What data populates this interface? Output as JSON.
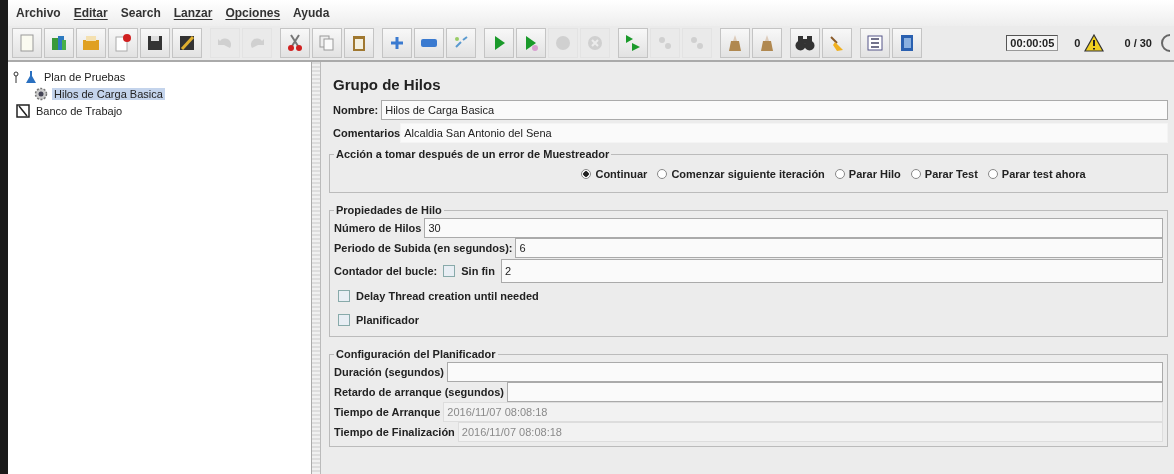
{
  "menu": [
    {
      "label": "Archivo",
      "mnemonic": false
    },
    {
      "label": "Editar",
      "mnemonic": true
    },
    {
      "label": "Search",
      "mnemonic": false
    },
    {
      "label": "Lanzar",
      "mnemonic": true
    },
    {
      "label": "Opciones",
      "mnemonic": true
    },
    {
      "label": "Ayuda",
      "mnemonic": false
    }
  ],
  "toolbar_groups": [
    {
      "buttons": [
        {
          "kind": "new",
          "disabled": false
        },
        {
          "kind": "templates",
          "disabled": false
        },
        {
          "kind": "open",
          "disabled": false
        },
        {
          "kind": "close",
          "disabled": false
        },
        {
          "kind": "save",
          "disabled": false
        },
        {
          "kind": "save_as",
          "disabled": false
        }
      ]
    },
    {
      "buttons": [
        {
          "kind": "undo",
          "disabled": true
        },
        {
          "kind": "redo",
          "disabled": true
        }
      ]
    },
    {
      "buttons": [
        {
          "kind": "cut",
          "disabled": false
        },
        {
          "kind": "copy",
          "disabled": false
        },
        {
          "kind": "paste",
          "disabled": false
        }
      ]
    },
    {
      "buttons": [
        {
          "kind": "expand",
          "disabled": false
        },
        {
          "kind": "collapse",
          "disabled": false
        },
        {
          "kind": "toggle",
          "disabled": false
        }
      ]
    },
    {
      "buttons": [
        {
          "kind": "start",
          "disabled": false
        },
        {
          "kind": "start_no_pause",
          "disabled": false
        },
        {
          "kind": "stop",
          "disabled": true
        },
        {
          "kind": "shutdown",
          "disabled": true
        }
      ]
    },
    {
      "buttons": [
        {
          "kind": "remote_start",
          "disabled": false
        },
        {
          "kind": "remote_stop",
          "disabled": true
        },
        {
          "kind": "remote_shutdown",
          "disabled": true
        }
      ]
    },
    {
      "buttons": [
        {
          "kind": "clear",
          "disabled": false
        },
        {
          "kind": "clear_all",
          "disabled": false
        }
      ]
    },
    {
      "buttons": [
        {
          "kind": "search",
          "disabled": false
        },
        {
          "kind": "reset_search",
          "disabled": false
        }
      ]
    },
    {
      "buttons": [
        {
          "kind": "function_helper",
          "disabled": false
        },
        {
          "kind": "help",
          "disabled": false
        }
      ]
    }
  ],
  "status": {
    "timer": "00:00:05",
    "warnings": "0",
    "threads": "0 / 30"
  },
  "tree": [
    {
      "label": "Plan de Pruebas",
      "kind": "plan",
      "selected": false,
      "expanded": true,
      "children": [
        {
          "label": "Hilos de Carga Basica",
          "kind": "thread_group",
          "selected": true
        }
      ]
    },
    {
      "label": "Banco de Trabajo",
      "kind": "workbench",
      "selected": false
    }
  ],
  "panel": {
    "title": "Grupo de Hilos",
    "name": {
      "label": "Nombre:",
      "value": "Hilos de Carga Basica"
    },
    "comments": {
      "label": "Comentarios",
      "value": "Alcaldia San Antonio del Sena"
    },
    "error_action": {
      "legend": "Acción a tomar después de un error de Muestreador",
      "options": [
        {
          "label": "Continuar",
          "selected": true
        },
        {
          "label": "Comenzar siguiente iteración",
          "selected": false
        },
        {
          "label": "Parar Hilo",
          "selected": false
        },
        {
          "label": "Parar Test",
          "selected": false
        },
        {
          "label": "Parar test ahora",
          "selected": false
        }
      ]
    },
    "thread_properties": {
      "legend": "Propiedades de Hilo",
      "threads": {
        "label": "Número de Hilos",
        "value": "30"
      },
      "ramp_up": {
        "label": "Periodo de Subida (en segundos):",
        "value": "6"
      },
      "loop": {
        "label": "Contador del bucle:",
        "forever_label": "Sin fin",
        "forever_checked": false,
        "value": "2"
      },
      "delay": {
        "label": "Delay Thread creation until needed",
        "checked": false
      },
      "scheduler": {
        "label": "Planificador",
        "checked": false
      }
    },
    "scheduler_config": {
      "legend": "Configuración del Planificador",
      "fields": [
        {
          "label": "Duración (segundos)",
          "disabled": false
        },
        {
          "label": "Retardo de arranque (segundos)",
          "disabled": false
        },
        {
          "label": "Tiempo de Arranque",
          "value": "2016/11/07 08:08:18",
          "disabled": true
        },
        {
          "label": "Tiempo de Finalización",
          "value": "2016/11/07 08:08:18",
          "disabled": true
        }
      ]
    }
  }
}
